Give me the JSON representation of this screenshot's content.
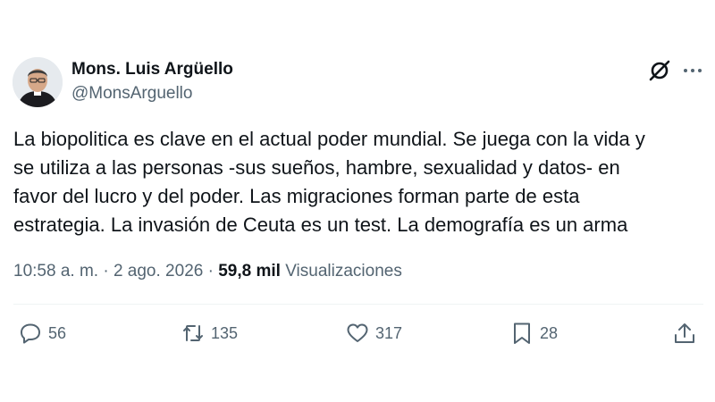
{
  "author": {
    "name": "Mons. Luis Argüello",
    "handle": "@MonsArguello"
  },
  "tweet": {
    "text": "La biopolitica es clave en el actual poder mundial. Se juega con la vida y\nse utiliza a las personas -sus sueños, hambre, sexualidad y datos- en\nfavor del lucro y del poder. Las migraciones forman parte de esta\nestrategia. La invasión de Ceuta es un test. La demografía es un arma"
  },
  "meta": {
    "time": "10:58 a. m.",
    "separator": "·",
    "date": "2 ago. 2026",
    "views_count": "59,8 mil",
    "views_label": "Visualizaciones"
  },
  "actions": {
    "replies": "56",
    "retweets": "135",
    "likes": "317",
    "bookmarks": "28"
  },
  "icons": [
    "grok-icon",
    "more-icon",
    "reply-icon",
    "retweet-icon",
    "like-icon",
    "bookmark-icon",
    "share-icon"
  ],
  "colors": {
    "text": "#0f1419",
    "secondary": "#536471",
    "divider": "#eff3f4"
  }
}
